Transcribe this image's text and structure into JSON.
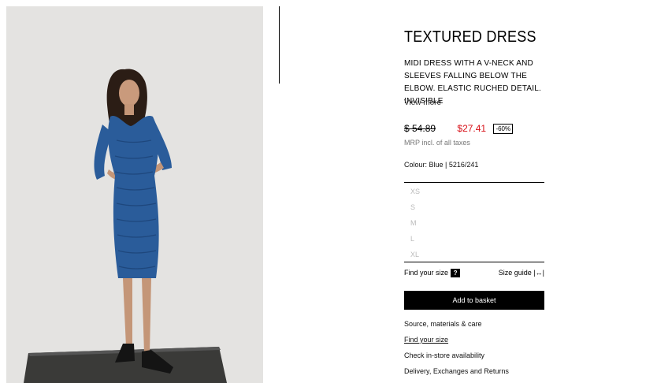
{
  "product": {
    "title": "TEXTURED DRESS",
    "description": "MIDI DRESS WITH A V-NECK AND SLEEVES FALLING BELOW THE ELBOW. ELASTIC RUCHED DETAIL. INVISIBLE",
    "view_more": "View more",
    "old_price": "$ 54.89",
    "new_price": "$27.41",
    "discount": "-60%",
    "tax_note": "MRP incl. of all taxes",
    "colour": "Colour: Blue | 5216/241",
    "sizes": [
      "XS",
      "S",
      "M",
      "L",
      "XL"
    ],
    "find_size": "Find your size",
    "find_size_icon": "?",
    "size_guide": "Size guide",
    "size_guide_icon": "|↔|",
    "add_to_basket": "Add to basket"
  },
  "links": {
    "source": "Source, materials & care",
    "find_size": "Find your size",
    "store": "Check in-store availability",
    "delivery": "Delivery, Exchanges and Returns"
  },
  "colors": {
    "price_red": "#d8121a",
    "dress_blue": "#2a5c9a"
  }
}
